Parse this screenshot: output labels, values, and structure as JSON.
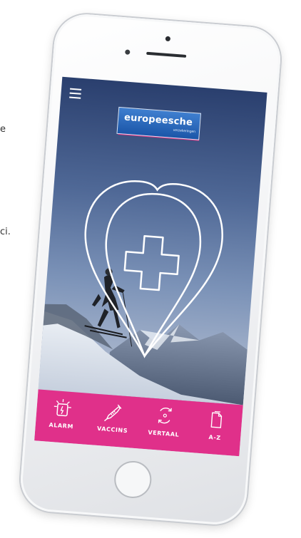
{
  "side_texts": [
    "e",
    "ci."
  ],
  "app": {
    "logo_text": "europeesche",
    "logo_subtext": "verzekeringen"
  },
  "nav": {
    "items": [
      {
        "label": "ALARM",
        "icon": "alarm-icon"
      },
      {
        "label": "VACCINS",
        "icon": "syringe-icon"
      },
      {
        "label": "VERTAAL",
        "icon": "translate-icon"
      },
      {
        "label": "A-Z",
        "icon": "document-icon"
      }
    ]
  },
  "colors": {
    "nav_background": "#e0308a",
    "logo_blue": "#1b56a8",
    "logo_pink": "#d8317e"
  }
}
